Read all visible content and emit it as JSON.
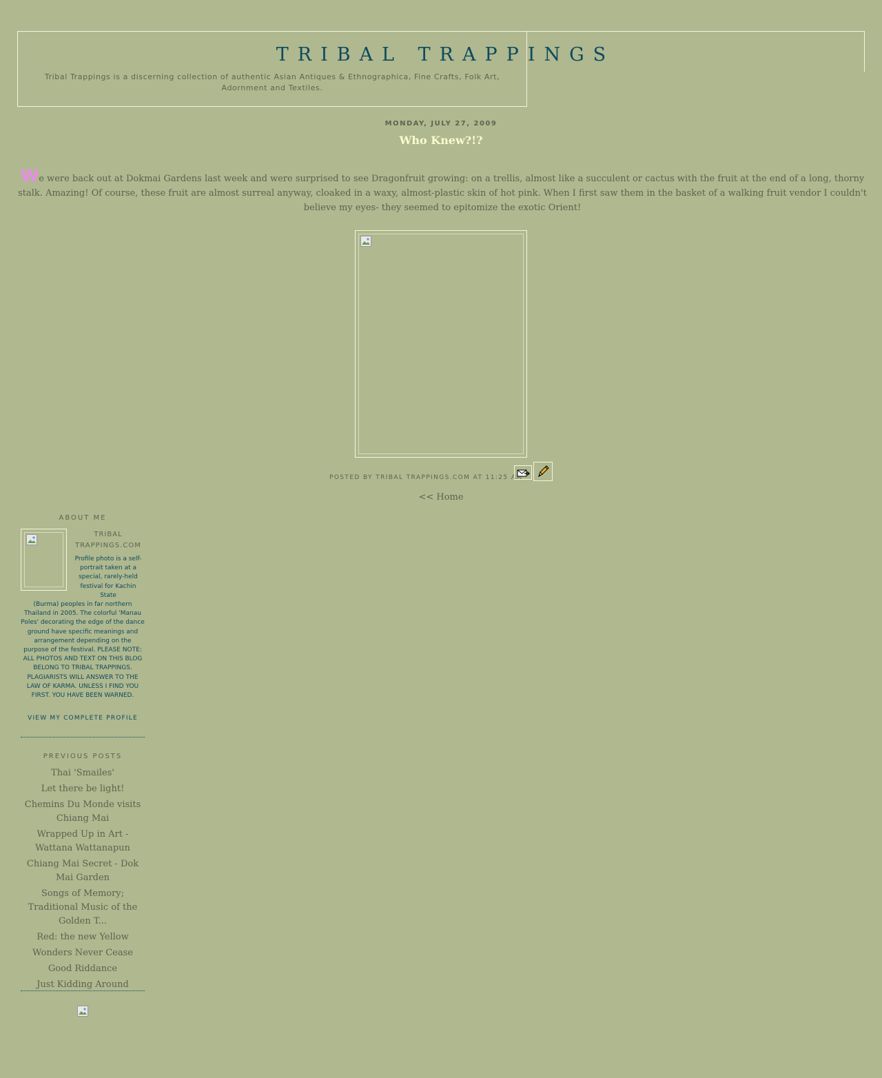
{
  "header": {
    "title": "TRIBAL TRAPPINGS",
    "description": "Tribal Trappings is a discerning collection of authentic Asian Antiques & Ethnographica, Fine Crafts, Folk Art, Adornment and Textiles."
  },
  "post": {
    "date": "MONDAY, JULY 27, 2009",
    "title": "Who Knew?!?",
    "drop_cap": "W",
    "body": "e were back out at Dokmai Gardens last week and were surprised to see Dragonfruit growing: on a trellis, almost like a succulent or cactus with the fruit at the end of a long, thorny stalk. Amazing! Of course, these fruit are almost surreal anyway, cloaked in a waxy, almost-plastic skin of hot pink. When I first saw them in the basket of a walking fruit vendor I couldn't believe my eyes- they seemed to epitomize the exotic Orient!",
    "footer_posted_by": "POSTED BY",
    "footer_author": "TRIBAL TRAPPINGS.COM",
    "footer_at": "AT",
    "footer_time": "11:25 AM"
  },
  "home_link": "<< Home",
  "sidebar": {
    "about_heading": "ABOUT ME",
    "profile_name": "TRIBAL TRAPPINGS.COM",
    "profile_text_top": "Profile photo is a self-portrait taken at a special, rarely-held festival for Kachin State",
    "profile_text_bottom": "(Burma) peoples in far northern Thailand in 2005. The colorful 'Manau Poles' decorating the edge of the dance ground have specific meanings and arrangement depending on the purpose of the festival. PLEASE NOTE: ALL PHOTOS AND TEXT ON THIS BLOG BELONG TO TRIBAL TRAPPINGS. PLAGIARISTS WILL ANSWER TO THE LAW OF KARMA. UNLESS I FIND YOU FIRST. YOU HAVE BEEN WARNED.",
    "profile_link": "VIEW MY COMPLETE PROFILE",
    "previous_heading": "PREVIOUS POSTS",
    "previous_posts": [
      "Thai 'Smailes'",
      "Let there be light!",
      "Chemins Du Monde visits Chiang Mai",
      "Wrapped Up in Art - Wattana Wattanapun",
      "Chiang Mai Secret - Dok Mai Garden",
      "Songs of Memory; Traditional Music of the Golden T...",
      "Red: the new Yellow",
      "Wonders Never Cease",
      "Good Riddance",
      "Just Kidding Around"
    ]
  },
  "icons": {
    "email": "email-post-icon",
    "edit": "edit-pencil-icon",
    "broken_image": "broken-image-icon"
  },
  "colors": {
    "background": "#afb88f",
    "title": "#0e4a5e",
    "post_title": "#fbfbce",
    "drop_cap": "#e88ce8",
    "border": "#f5f5dc"
  }
}
